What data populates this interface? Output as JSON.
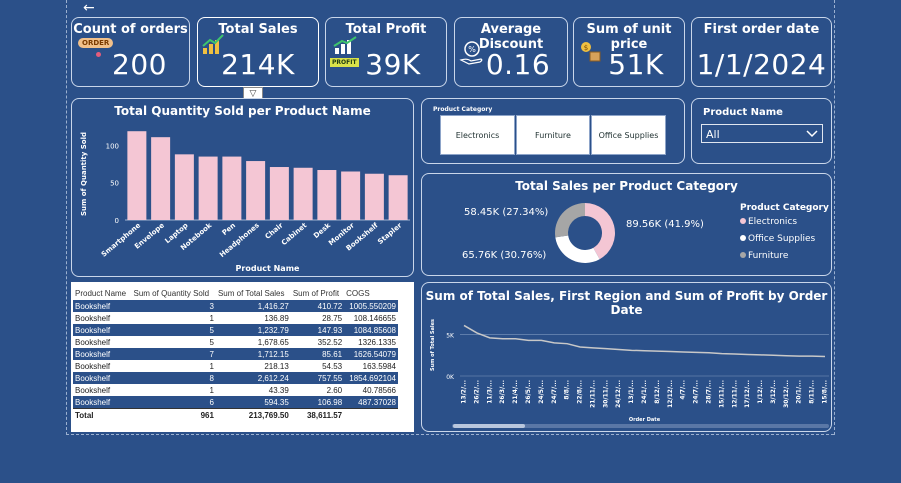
{
  "nav": {
    "back_icon": "arrow-left-icon",
    "filter_icon": "funnel-icon"
  },
  "kpis": [
    {
      "title": "Count of orders",
      "value": "200",
      "badge": "ORDER",
      "icon": "order-tag-icon"
    },
    {
      "title": "Total Sales",
      "value": "214K",
      "icon": "sales-chart-icon"
    },
    {
      "title": "Total Profit",
      "value": "39K",
      "badge": "PROFIT",
      "icon": "profit-chart-icon"
    },
    {
      "title": "Average Discount",
      "value": "0.16",
      "icon": "discount-hand-icon"
    },
    {
      "title": "Sum of unit price",
      "value": "51K",
      "icon": "coins-box-icon"
    },
    {
      "title": "First order date",
      "value": "1/1/2024"
    }
  ],
  "qty_chart": {
    "title": "Total Quantity Sold per Product Name",
    "chart_data": {
      "type": "bar",
      "title": "Total Quantity Sold per Product Name",
      "xlabel": "Product Name",
      "ylabel": "Sum of Quantity Sold",
      "categories": [
        "Smartphone",
        "Envelope",
        "Laptop",
        "Notebook",
        "Pen",
        "Headphones",
        "Chair",
        "Cabinet",
        "Desk",
        "Monitor",
        "Bookshelf",
        "Stapler"
      ],
      "values": [
        119,
        111,
        88,
        85,
        85,
        79,
        71,
        70,
        67,
        65,
        62,
        60
      ],
      "yticks": [
        "0",
        "50",
        "100"
      ],
      "ylim": [
        0,
        130
      ],
      "color": "#f4c6d4"
    }
  },
  "category_slicer": {
    "title": "Product Category",
    "options": [
      "Electronics",
      "Furniture",
      "Office Supplies"
    ]
  },
  "product_slicer": {
    "title": "Product Name",
    "selected": "All"
  },
  "pie_chart": {
    "title": "Total Sales per Product Category",
    "legend_title": "Product Category",
    "chart_data": {
      "type": "pie",
      "title": "Total Sales per Product Category",
      "categories": [
        "Electronics",
        "Office Supplies",
        "Furniture"
      ],
      "values": [
        89.56,
        65.76,
        58.45
      ],
      "labels": [
        "89.56K (41.9%)",
        "65.76K (30.76%)",
        "58.45K (27.34%)"
      ],
      "colors": [
        "#f4c6d4",
        "#ffffff",
        "#a6a6a6"
      ]
    }
  },
  "table": {
    "headers": [
      "Product Name",
      "Sum of Quantity Sold",
      "Sum of Total Sales",
      "Sum of Profit",
      "COGS"
    ],
    "rows": [
      [
        "Bookshelf",
        "3",
        "1,416.27",
        "410.72",
        "1005.550209"
      ],
      [
        "Bookshelf",
        "1",
        "136.89",
        "28.75",
        "108.146655"
      ],
      [
        "Bookshelf",
        "5",
        "1,232.79",
        "147.93",
        "1084.85608"
      ],
      [
        "Bookshelf",
        "5",
        "1,678.65",
        "352.52",
        "1326.1335"
      ],
      [
        "Bookshelf",
        "7",
        "1,712.15",
        "85.61",
        "1626.54079"
      ],
      [
        "Bookshelf",
        "1",
        "218.13",
        "54.53",
        "163.5984"
      ],
      [
        "Bookshelf",
        "8",
        "2,612.24",
        "757.55",
        "1854.692104"
      ],
      [
        "Bookshelf",
        "1",
        "43.39",
        "2.60",
        "40.78566"
      ],
      [
        "Bookshelf",
        "6",
        "594.35",
        "106.98",
        "487.37028"
      ]
    ],
    "selected_rows": [
      0,
      2,
      4,
      6,
      8
    ],
    "total": [
      "Total",
      "961",
      "213,769.50",
      "38,611.57",
      ""
    ]
  },
  "line_chart": {
    "title": "Sum of Total Sales, First Region and Sum of Profit by Order Date",
    "chart_data": {
      "type": "line",
      "title": "Sum of Total Sales, First Region and Sum of Profit by Order Date",
      "xlabel": "Order Date",
      "ylabel": "Sum of Total Sales",
      "yticks": [
        "0K",
        "5K"
      ],
      "ylim": [
        0,
        7000
      ],
      "x": [
        "13/2/...",
        "26/2/...",
        "11/3/...",
        "26/3/...",
        "21/4/...",
        "26/5/...",
        "24/5/...",
        "24/7/...",
        "8/8/...",
        "22/8/...",
        "21/11/...",
        "30/11/...",
        "24/12/...",
        "13/1/...",
        "24/1/...",
        "8/12/...",
        "12/12/...",
        "4/7/...",
        "24/7/...",
        "28/7/...",
        "15/11/...",
        "12/11/...",
        "17/12/...",
        "1/12/...",
        "3/12/...",
        "30/12/...",
        "20/1/...",
        "8/11/...",
        "15/8/..."
      ],
      "values": [
        6100,
        5200,
        4600,
        4500,
        4500,
        4300,
        4300,
        4000,
        3900,
        3500,
        3400,
        3300,
        3200,
        3100,
        3050,
        3000,
        2950,
        2900,
        2850,
        2800,
        2700,
        2650,
        2600,
        2550,
        2500,
        2450,
        2400,
        2400,
        2350
      ],
      "color": "#c8c8c8"
    }
  }
}
